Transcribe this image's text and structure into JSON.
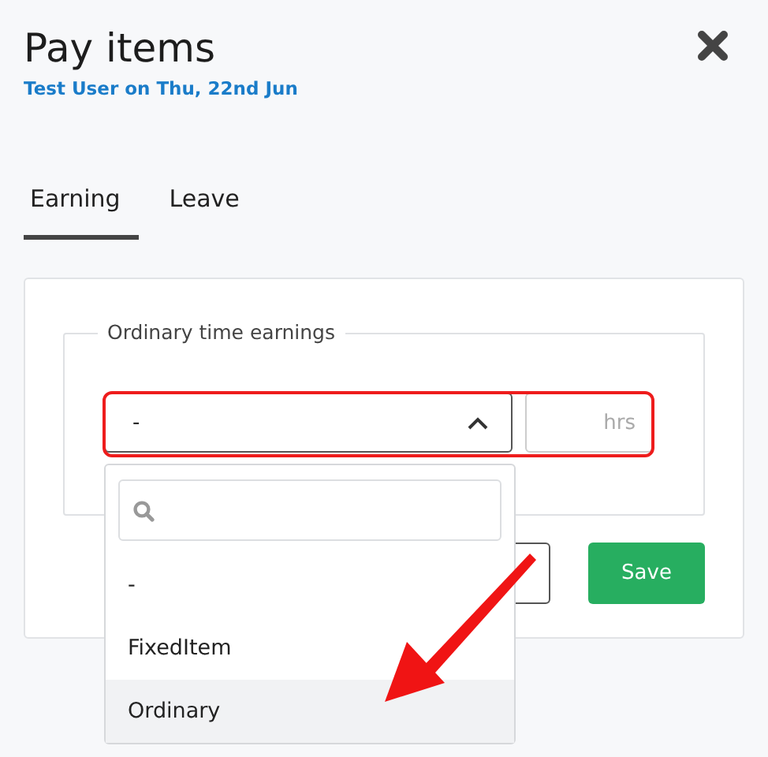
{
  "dialog": {
    "title": "Pay items",
    "subtitle": "Test User on Thu, 22nd Jun"
  },
  "tabs": [
    {
      "label": "Earning",
      "selected": true
    },
    {
      "label": "Leave",
      "selected": false
    }
  ],
  "fieldset": {
    "legend": "Ordinary time earnings",
    "select": {
      "value": "-",
      "expanded": true
    },
    "hours": {
      "placeholder": "hrs"
    }
  },
  "dropdown": {
    "options": [
      {
        "label": "-",
        "highlighted": false
      },
      {
        "label": "FixedItem",
        "highlighted": false
      },
      {
        "label": "Ordinary",
        "highlighted": true
      }
    ]
  },
  "buttons": [
    {
      "kind": "outline"
    },
    {
      "kind": "primary",
      "label": "Save"
    }
  ],
  "annotations": {
    "highlight_box": true,
    "arrow": true
  }
}
